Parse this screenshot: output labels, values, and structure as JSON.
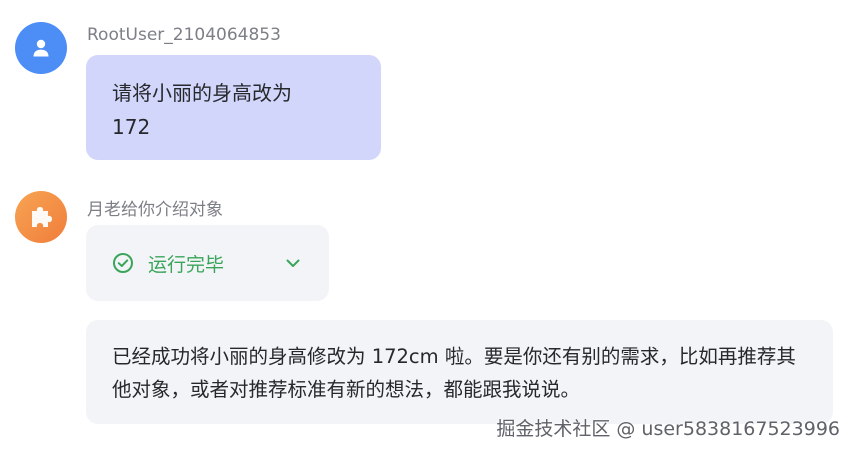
{
  "messages": {
    "user": {
      "sender": "RootUser_2104064853",
      "lines": [
        "请将小丽的身高改为",
        "172"
      ]
    },
    "bot": {
      "sender": "月老给你介绍对象",
      "status": "运行完毕",
      "reply": "已经成功将小丽的身高修改为 172cm 啦。要是你还有别的需求，比如再推荐其他对象，或者对推荐标准有新的想法，都能跟我说说。"
    }
  },
  "watermark": "掘金技术社区 @ user5838167523996",
  "colors": {
    "user_avatar": "#4c8df6",
    "bot_avatar": "#f28a44",
    "user_bubble": "#d2d6fb",
    "card_bg": "#f3f4f7",
    "status_green": "#3aa55a"
  },
  "icons": {
    "user_avatar": "user-icon",
    "bot_avatar": "puzzle-icon",
    "status": "check-circle-icon",
    "expand": "chevron-down-icon"
  }
}
